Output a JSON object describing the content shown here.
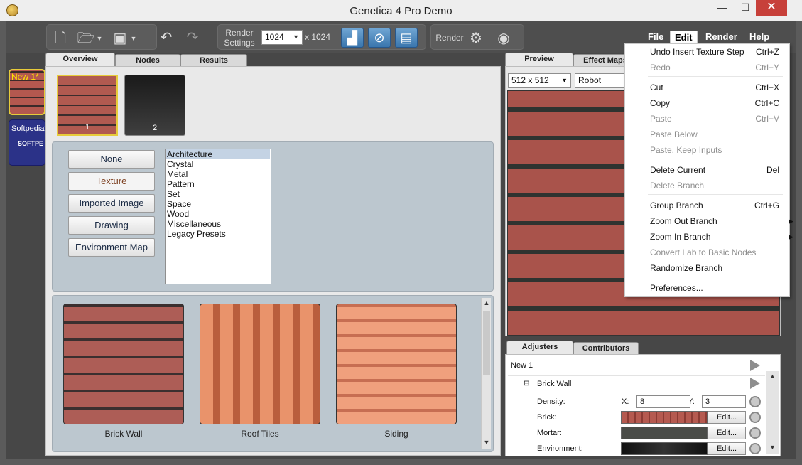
{
  "window": {
    "title": "Genetica 4 Pro Demo",
    "minimize": "—",
    "maximize": "☐",
    "close": "✕"
  },
  "toolbar": {
    "render_settings_label": "Render\nSettings",
    "resolution": "1024",
    "resolution_x": "x 1024",
    "render_label": "Render"
  },
  "menu": {
    "file": "File",
    "edit": "Edit",
    "render": "Render",
    "help": "Help"
  },
  "nodes": {
    "new1": "New 1*",
    "softpedia": "Softpedia*",
    "softpedia_logo": "SOFTPE"
  },
  "left_tabs": [
    "Overview",
    "Nodes",
    "Results"
  ],
  "thumbs": [
    "1",
    "2"
  ],
  "preset_buttons": [
    "None",
    "Texture",
    "Imported Image",
    "Drawing",
    "Environment Map"
  ],
  "categories": [
    "Architecture",
    "Crystal",
    "Metal",
    "Pattern",
    "Set",
    "Space",
    "Wood",
    "Miscellaneous",
    "Legacy Presets"
  ],
  "gallery": [
    "Brick Wall",
    "Roof Tiles",
    "Siding"
  ],
  "right_tabs": [
    "Preview",
    "Effect Maps"
  ],
  "preview": {
    "size": "512 x 512",
    "mode": "Robot"
  },
  "adjuster_tabs": [
    "Adjusters",
    "Contributors"
  ],
  "adjusters": {
    "root": "New 1",
    "branch": "Brick Wall",
    "density_label": "Density:",
    "x_label": "X:",
    "x_value": "8",
    "y_label": "Y:",
    "y_value": "3",
    "brick_label": "Brick:",
    "mortar_label": "Mortar:",
    "environment_label": "Environment:",
    "edit_label": "Edit..."
  },
  "edit_menu": [
    {
      "label": "Undo Insert Texture Step",
      "shortcut": "Ctrl+Z",
      "enabled": true
    },
    {
      "label": "Redo",
      "shortcut": "Ctrl+Y",
      "enabled": false
    },
    {
      "label": "Cut",
      "shortcut": "Ctrl+X",
      "enabled": true
    },
    {
      "label": "Copy",
      "shortcut": "Ctrl+C",
      "enabled": true
    },
    {
      "label": "Paste",
      "shortcut": "Ctrl+V",
      "enabled": false
    },
    {
      "label": "Paste Below",
      "shortcut": "",
      "enabled": false
    },
    {
      "label": "Paste, Keep Inputs",
      "shortcut": "",
      "enabled": false
    },
    {
      "label": "Delete Current",
      "shortcut": "Del",
      "enabled": true
    },
    {
      "label": "Delete Branch",
      "shortcut": "",
      "enabled": false
    },
    {
      "label": "Group Branch",
      "shortcut": "Ctrl+G",
      "enabled": true
    },
    {
      "label": "Zoom Out Branch",
      "shortcut": "",
      "enabled": true
    },
    {
      "label": "Zoom In Branch",
      "shortcut": "",
      "enabled": true
    },
    {
      "label": "Convert Lab to Basic Nodes",
      "shortcut": "",
      "enabled": false
    },
    {
      "label": "Randomize Branch",
      "shortcut": "",
      "enabled": true
    },
    {
      "label": "Preferences...",
      "shortcut": "",
      "enabled": true
    }
  ],
  "colors": {
    "accent": "#3a76ad",
    "selection_border": "#e7cc3a",
    "close_button": "#c7403a"
  }
}
